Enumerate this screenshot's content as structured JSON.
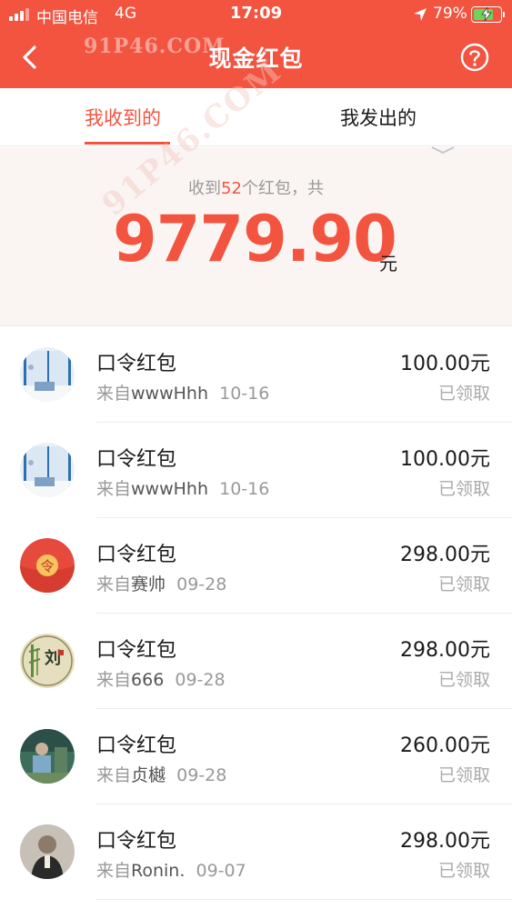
{
  "status_bar": {
    "carrier": "中国电信",
    "network": "4G",
    "time": "17:09",
    "battery_percent": "79%",
    "battery_level": 0.79
  },
  "nav": {
    "title": "现金红包",
    "back_icon": "chevron-left-icon",
    "help_icon": "question-circle-icon"
  },
  "watermark": {
    "text1": "91P46.COM",
    "text2": "91P46.COM"
  },
  "tabs": [
    {
      "label": "我收到的",
      "active": true
    },
    {
      "label": "我发出的",
      "active": false
    }
  ],
  "summary": {
    "prefix": "收到",
    "count": "52",
    "suffix": "个红包，共",
    "total": "9779.90",
    "unit": "元"
  },
  "colors": {
    "brand": "#f25440",
    "background": "#faf5f2"
  },
  "records": [
    {
      "title": "口令红包",
      "from": "来自",
      "sender": "wwwHhh",
      "date": "10-16",
      "amount": "100.00元",
      "status": "已领取",
      "avatar": "window-scene"
    },
    {
      "title": "口令红包",
      "from": "来自",
      "sender": "wwwHhh",
      "date": "10-16",
      "amount": "100.00元",
      "status": "已领取",
      "avatar": "window-scene"
    },
    {
      "title": "口令红包",
      "from": "来自",
      "sender": "赛帅",
      "date": "09-28",
      "amount": "298.00元",
      "status": "已领取",
      "avatar": "red-packet-ling",
      "avatar_text": "令"
    },
    {
      "title": "口令红包",
      "from": "来自",
      "sender": "666",
      "date": "09-28",
      "amount": "298.00元",
      "status": "已领取",
      "avatar": "bamboo-calligraphy",
      "avatar_text": "刘"
    },
    {
      "title": "口令红包",
      "from": "来自",
      "sender": "贞樾",
      "date": "09-28",
      "amount": "260.00元",
      "status": "已领取",
      "avatar": "green-photo"
    },
    {
      "title": "口令红包",
      "from": "来自",
      "sender": "Ronin.",
      "date": "09-07",
      "amount": "298.00元",
      "status": "已领取",
      "avatar": "portrait-photo"
    }
  ]
}
